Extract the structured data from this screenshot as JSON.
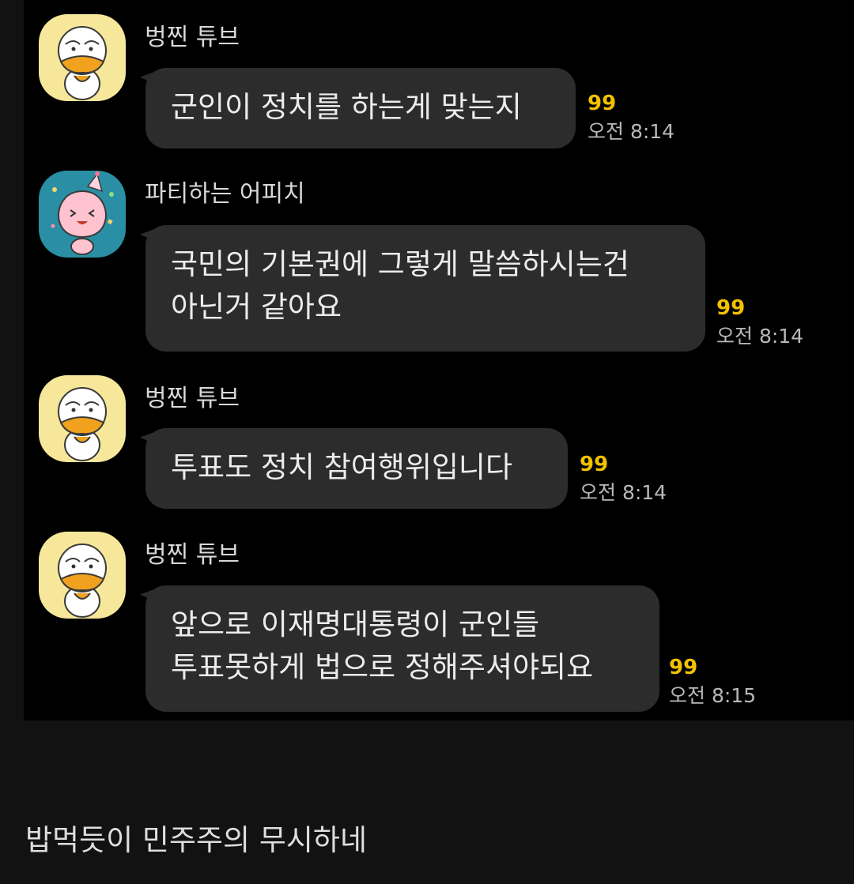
{
  "messages": [
    {
      "sender": "벙찐 튜브",
      "avatar_icon": "tube-duck-avatar-icon",
      "lines": [
        "군인이 정치를 하는게 맞는지"
      ],
      "unread": "99",
      "time": "오전 8:14"
    },
    {
      "sender": "파티하는 어피치",
      "avatar_icon": "party-apeach-avatar-icon",
      "lines": [
        "국민의 기본권에 그렇게 말씀하시는건",
        "아닌거 같아요"
      ],
      "unread": "99",
      "time": "오전 8:14"
    },
    {
      "sender": "벙찐 튜브",
      "avatar_icon": "tube-duck-avatar-icon",
      "lines": [
        "투표도 정치 참여행위입니다"
      ],
      "unread": "99",
      "time": "오전 8:14"
    },
    {
      "sender": "벙찐 튜브",
      "avatar_icon": "tube-duck-avatar-icon",
      "lines": [
        "앞으로 이재명대통령이 군인들",
        "투표못하게 법으로 정해주셔야되요"
      ],
      "unread": "99",
      "time": "오전 8:15"
    }
  ],
  "caption": "밥먹듯이 민주주의 무시하네",
  "colors": {
    "chat_background": "#000000",
    "page_background": "#121212",
    "bubble": "#2c2c2c",
    "unread_count": "#f2c200",
    "tube_avatar_bg": "#f6e79a",
    "apeach_avatar_bg": "#2a8fa5"
  }
}
